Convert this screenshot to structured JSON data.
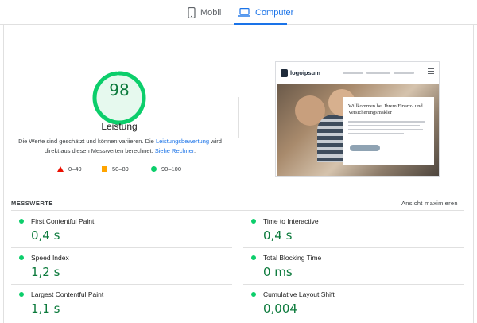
{
  "tabs": {
    "mobile_label": "Mobil",
    "desktop_label": "Computer"
  },
  "score": {
    "value": "98",
    "title": "Leistung",
    "desc_part1": "Die Werte sind geschätzt und können variieren. Die ",
    "desc_link1": "Leistungsbewertung",
    "desc_part2": " wird direkt aus diesen Messwerten berechnet. ",
    "desc_link2": "Siehe Rechner",
    "desc_part3": ".",
    "gauge_color": "#0cce6b",
    "gauge_bg": "#e6f9ee"
  },
  "legend": {
    "red_label": "0–49",
    "orange_label": "50–89",
    "green_label": "90–100"
  },
  "preview": {
    "logo_text": "logoipsum",
    "headline": "Willkommen bei Ihrem Finanz- und Versicherungsmakler"
  },
  "metrics": {
    "section_label": "MESSWERTE",
    "expand_label": "Ansicht maximieren",
    "items": [
      {
        "name": "First Contentful Paint",
        "value": "0,4 s"
      },
      {
        "name": "Time to Interactive",
        "value": "0,4 s"
      },
      {
        "name": "Speed Index",
        "value": "1,2 s"
      },
      {
        "name": "Total Blocking Time",
        "value": "0 ms"
      },
      {
        "name": "Largest Contentful Paint",
        "value": "1,1 s"
      },
      {
        "name": "Cumulative Layout Shift",
        "value": "0,004"
      }
    ]
  },
  "colors": {
    "accent": "#1a73e8",
    "pass": "#0cce6b",
    "pass_text": "#0c7a3c",
    "average": "#ffa400",
    "fail": "#eb0f00"
  }
}
